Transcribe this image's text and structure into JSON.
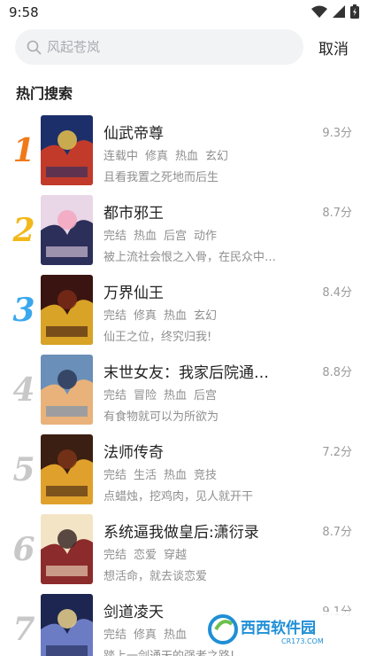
{
  "status_bar": {
    "time": "9:58"
  },
  "search": {
    "placeholder": "风起苍岚",
    "cancel_label": "取消"
  },
  "section_title": "热门搜索",
  "colors": {
    "rank_1": "#f07a1a",
    "rank_2": "#f2b81b",
    "rank_3": "#3aa7ee",
    "rank_other": "#c8c8c8"
  },
  "items": [
    {
      "rank": "1",
      "title": "仙武帝尊",
      "score": "9.3分",
      "tags": [
        "连载中",
        "修真",
        "热血",
        "玄幻"
      ],
      "desc": "且看我置之死地而后生",
      "cover_colors": [
        "#1c2f6b",
        "#c23a2a",
        "#e8c04a"
      ]
    },
    {
      "rank": "2",
      "title": "都市邪王",
      "score": "8.7分",
      "tags": [
        "完结",
        "热血",
        "后宫",
        "动作"
      ],
      "desc": "被上流社会恨之入骨，在民众中…",
      "cover_colors": [
        "#e9d6e6",
        "#2b2f5a",
        "#f4a7c0"
      ]
    },
    {
      "rank": "3",
      "title": "万界仙王",
      "score": "8.4分",
      "tags": [
        "完结",
        "修真",
        "热血",
        "玄幻"
      ],
      "desc": "仙王之位，终究归我!",
      "cover_colors": [
        "#3a1410",
        "#d8a326",
        "#7a2a18"
      ]
    },
    {
      "rank": "4",
      "title": "末世女友：我家后院通…",
      "score": "8.8分",
      "tags": [
        "完结",
        "冒险",
        "热血",
        "后宫"
      ],
      "desc": "有食物就可以为所欲为",
      "cover_colors": [
        "#6a8fb8",
        "#e9b27a",
        "#2d3a58"
      ]
    },
    {
      "rank": "5",
      "title": "法师传奇",
      "score": "7.2分",
      "tags": [
        "完结",
        "生活",
        "热血",
        "竞技"
      ],
      "desc": "点蜡烛，挖鸡肉，见人就开干",
      "cover_colors": [
        "#3b1f12",
        "#e0a12c",
        "#7c3518"
      ]
    },
    {
      "rank": "6",
      "title": "系统逼我做皇后:潇衍录",
      "score": "8.7分",
      "tags": [
        "完结",
        "恋爱",
        "穿越"
      ],
      "desc": "想活命，就去谈恋爱",
      "cover_colors": [
        "#f3e4c6",
        "#8c2b2b",
        "#3d2c2a"
      ]
    },
    {
      "rank": "7",
      "title": "剑道凌天",
      "score": "9.1分",
      "tags": [
        "完结",
        "修真",
        "热血"
      ],
      "desc": "踏上一剑通天的强者之路!",
      "cover_colors": [
        "#1d2650",
        "#6c7cc4",
        "#e9d08a"
      ]
    }
  ],
  "watermark": {
    "text": "西西软件园",
    "domain": "CR173.COM"
  }
}
